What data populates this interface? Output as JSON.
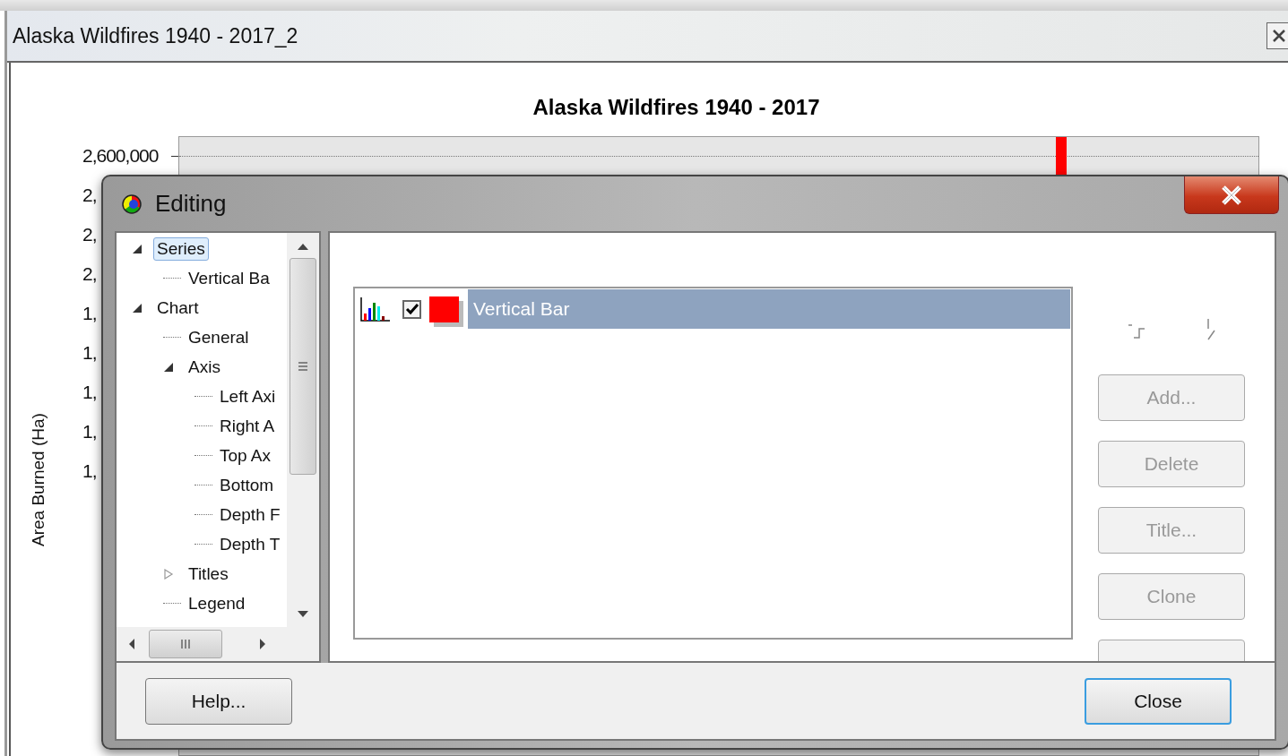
{
  "window": {
    "title": "Alaska Wildfires 1940 - 2017_2"
  },
  "chart": {
    "title": "Alaska Wildfires 1940 - 2017",
    "y_axis_title": "Area Burned (Ha)",
    "y_labels": [
      "2,600,000",
      "2,",
      "2,",
      "2,",
      "1,",
      "1,",
      "1,",
      "1,",
      "1,"
    ]
  },
  "dialog": {
    "title": "Editing",
    "tree": [
      {
        "label": "Series",
        "selected": true,
        "expanded": true,
        "children": [
          {
            "label": "Vertical Ba",
            "selected": false
          }
        ]
      },
      {
        "label": "Chart",
        "selected": false,
        "expanded": true,
        "children": [
          {
            "label": "General",
            "selected": false
          },
          {
            "label": "Axis",
            "selected": false,
            "expanded": true,
            "children": [
              {
                "label": "Left Axi",
                "selected": false
              },
              {
                "label": "Right A",
                "selected": false
              },
              {
                "label": "Top Ax",
                "selected": false
              },
              {
                "label": "Bottom",
                "selected": false
              },
              {
                "label": "Depth F",
                "selected": false
              },
              {
                "label": "Depth T",
                "selected": false
              }
            ]
          },
          {
            "label": "Titles",
            "selected": false,
            "expanded": false
          },
          {
            "label": "Legend",
            "selected": false
          }
        ]
      }
    ],
    "series_list": [
      {
        "label": "Vertical Bar",
        "checked": true,
        "color": "#ff0000",
        "selected": true
      }
    ],
    "buttons": [
      {
        "label": "Add...",
        "disabled": true
      },
      {
        "label": "Delete",
        "disabled": true
      },
      {
        "label": "Title...",
        "disabled": true
      },
      {
        "label": "Clone",
        "disabled": true
      }
    ],
    "footer_buttons": [
      {
        "label": "Help...",
        "default": false
      },
      {
        "label": "Close",
        "default": true
      }
    ]
  }
}
